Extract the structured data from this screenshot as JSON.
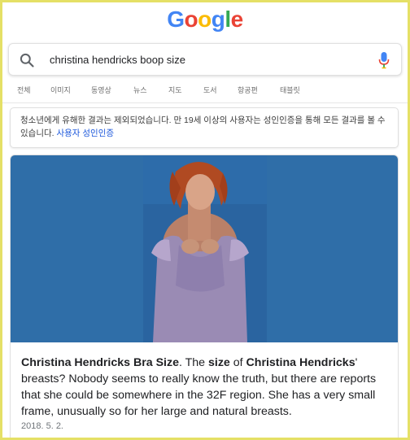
{
  "logo": {
    "letters": [
      "G",
      "o",
      "o",
      "g",
      "l",
      "e"
    ],
    "colors": [
      "#4285F4",
      "#EA4335",
      "#FBBC05",
      "#4285F4",
      "#34A853",
      "#EA4335"
    ]
  },
  "search": {
    "query": "christina hendricks boop size",
    "icon": "search-icon",
    "voice_icon": "mic-icon"
  },
  "tabs": [
    "전체",
    "이미지",
    "동영상",
    "뉴스",
    "지도",
    "도서",
    "항공편",
    "태블릿"
  ],
  "notice": {
    "text": "청소년에게 유해한 결과는 제외되었습니다. 만 19세 이상의 사용자는 성인인증을 통해 모든 결과를 볼 수 있습니다.",
    "link": "사용자 성인인증"
  },
  "result": {
    "title_bold": "Christina Hendricks Bra Size",
    "text_1": ". The ",
    "bold_2": "size",
    "text_2": " of ",
    "bold_3": "Christina Hendricks",
    "text_3": "' breasts? Nobody seems to really know the truth, but there are reports that she could be somewhere in the 32F region. She has a very small frame, unusually so for her large and natural breasts.",
    "date": "2018. 5. 2."
  },
  "colors": {
    "image_bg": "#2f6ea8",
    "link": "#1a56db",
    "mic_blue": "#4285F4",
    "mic_red": "#EA4335"
  }
}
